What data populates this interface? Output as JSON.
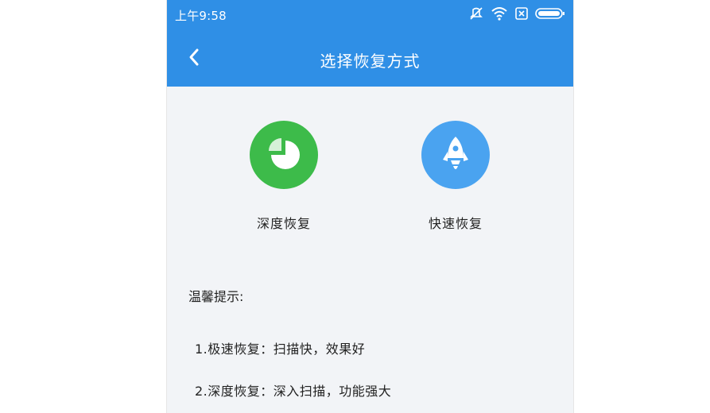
{
  "status_bar": {
    "time": "上午9:58",
    "icons": [
      "mute-icon",
      "wifi-icon",
      "sim-icon",
      "battery-icon"
    ]
  },
  "header": {
    "title": "选择恢复方式",
    "back_icon": "chevron-left-icon"
  },
  "options": [
    {
      "label": "深度恢复",
      "icon": "pie-chart-icon",
      "color": "#3dbb4a"
    },
    {
      "label": "快速恢复",
      "icon": "rocket-icon",
      "color": "#4aa3f0"
    }
  ],
  "tips": {
    "title": "温馨提示:",
    "items": [
      "1.极速恢复：扫描快，效果好",
      "2.深度恢复：深入扫描，功能强大"
    ]
  },
  "colors": {
    "primary": "#2f8fe6",
    "background": "#f2f4f7",
    "text": "#222222"
  }
}
